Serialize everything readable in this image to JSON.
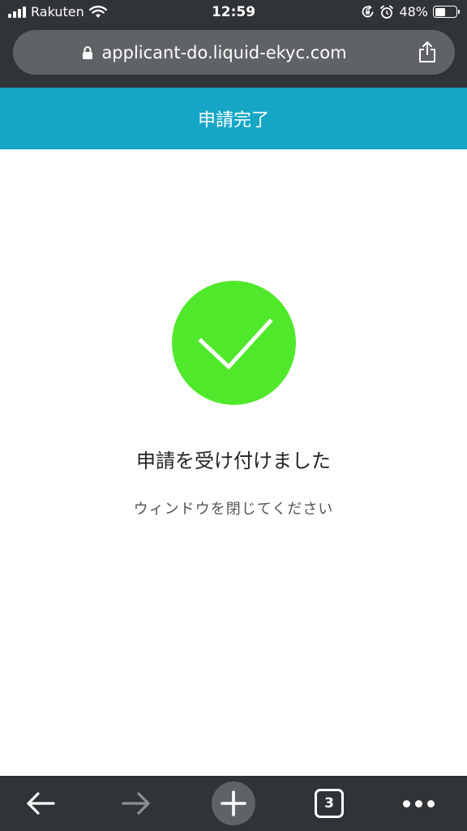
{
  "status_bar": {
    "carrier": "Rakuten",
    "time": "12:59",
    "battery_percent": "48%",
    "battery_level": 0.48
  },
  "browser": {
    "url": "applicant-do.liquid-ekyc.com",
    "open_tabs": "3"
  },
  "page": {
    "header_title": "申請完了",
    "message_title": "申請を受け付けました",
    "message_subtitle": "ウィンドウを閉じてください"
  },
  "colors": {
    "chrome": "#303437",
    "url_pill": "#5f6366",
    "header": "#15a6c6",
    "success": "#50e82a"
  },
  "icons": {
    "lock": "lock-icon",
    "share": "share-icon",
    "check": "checkmark-icon",
    "back": "arrow-left-icon",
    "forward": "arrow-right-icon",
    "new_tab": "plus-icon",
    "tabs": "tab-switcher-icon",
    "more": "more-dots-icon"
  }
}
